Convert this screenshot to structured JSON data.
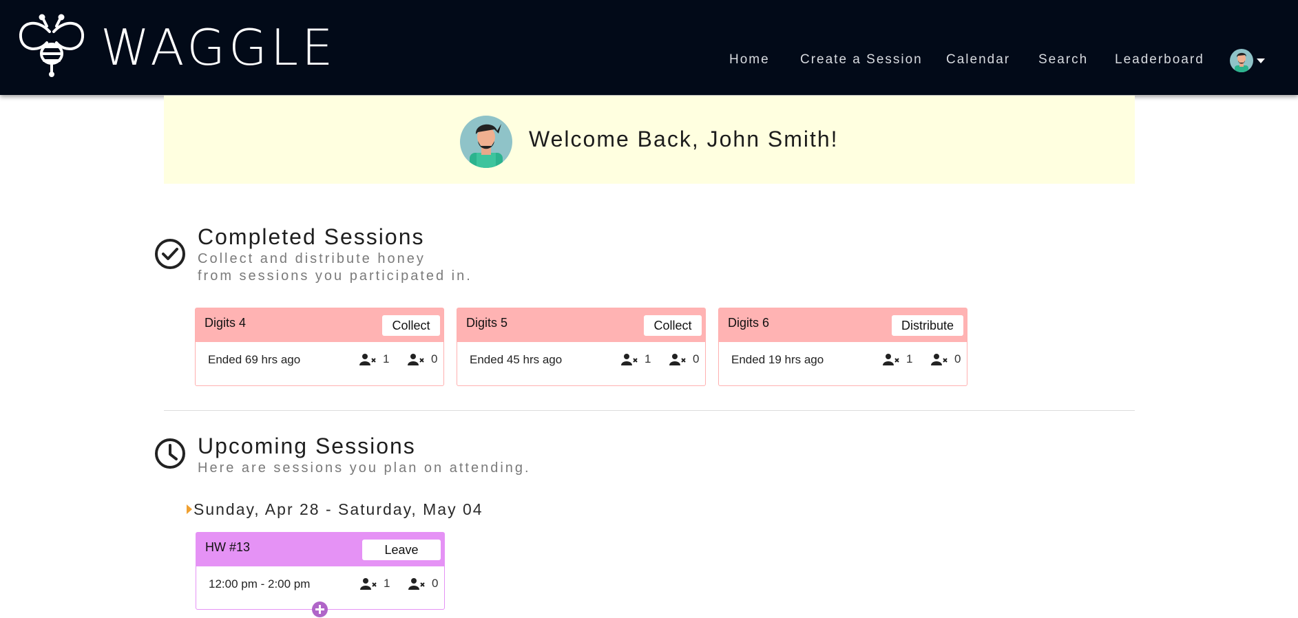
{
  "header": {
    "logo_text": "WAGGLE",
    "nav": [
      {
        "label": "Home"
      },
      {
        "label": "Create a Session"
      },
      {
        "label": "Calendar"
      },
      {
        "label": "Search"
      },
      {
        "label": "Leaderboard"
      }
    ]
  },
  "banner": {
    "welcome": "Welcome Back, John Smith!"
  },
  "completed": {
    "title": "Completed Sessions",
    "subtitle_line1": "Collect and distribute honey",
    "subtitle_line2": "from sessions you participated in.",
    "cards": [
      {
        "name": "Digits 4",
        "action": "Collect",
        "time": "Ended 69 hrs ago",
        "stat1": "1",
        "stat2": "0"
      },
      {
        "name": "Digits 5",
        "action": "Collect",
        "time": "Ended 45 hrs ago",
        "stat1": "1",
        "stat2": "0"
      },
      {
        "name": "Digits 6",
        "action": "Distribute",
        "time": "Ended 19 hrs ago",
        "stat1": "1",
        "stat2": "0"
      }
    ]
  },
  "upcoming": {
    "title": "Upcoming Sessions",
    "subtitle": "Here are sessions you plan on attending.",
    "week_label": "Sunday, Apr 28 - Saturday, May 04",
    "cards": [
      {
        "name": "HW #13",
        "action": "Leave",
        "time": "12:00 pm - 2:00 pm",
        "stat1": "1",
        "stat2": "0"
      }
    ]
  },
  "colors": {
    "navbar": "#020a18",
    "banner": "#ffffe0",
    "completed_card": "#ffb3b3",
    "upcoming_card": "#e592f5",
    "week_caret": "#f0a030"
  },
  "icons": {
    "logo": "bee-icon",
    "completed": "check-circle-icon",
    "upcoming": "clock-icon",
    "stat": "user-x-icon",
    "add": "plus-circle-icon"
  }
}
